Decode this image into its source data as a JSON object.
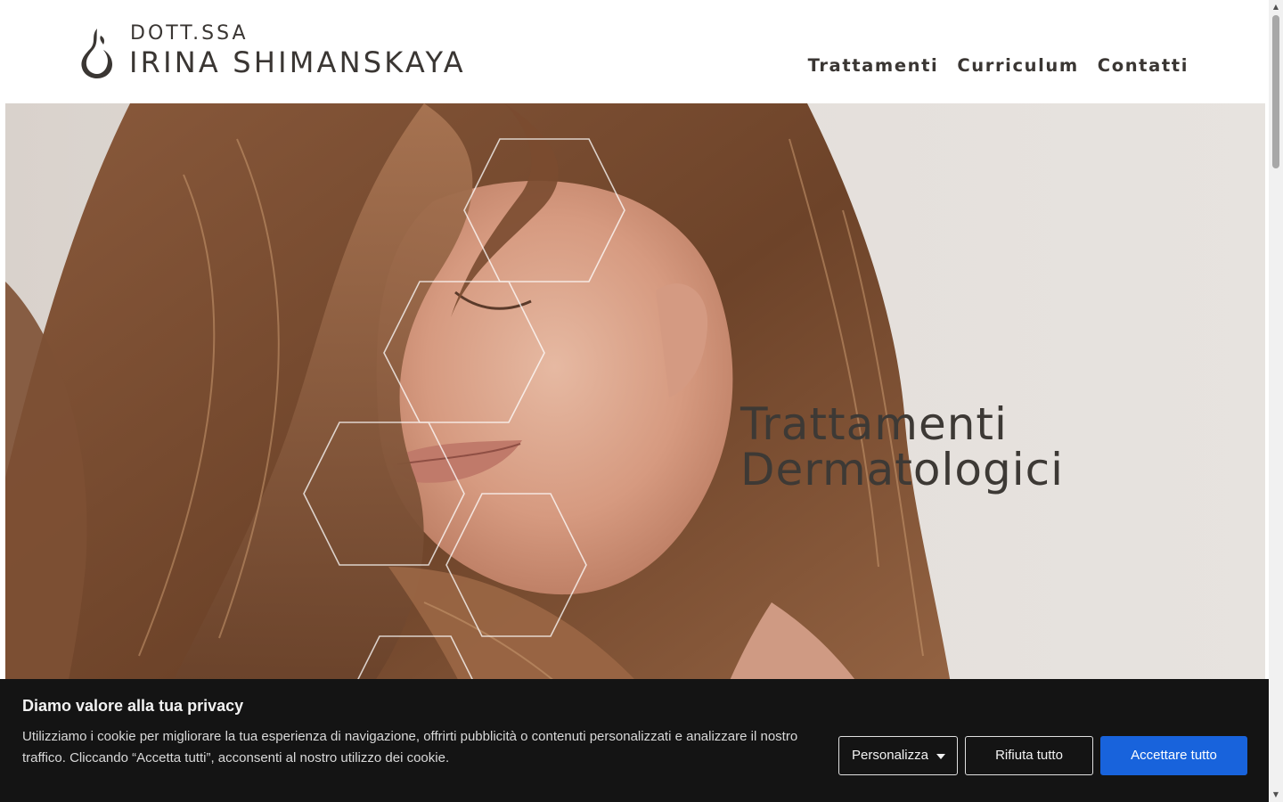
{
  "header": {
    "logo_title": "DOTT.SSA",
    "logo_name": "IRINA SHIMANSKAYA",
    "nav": [
      {
        "label": "Trattamenti"
      },
      {
        "label": "Curriculum"
      },
      {
        "label": "Contatti"
      }
    ]
  },
  "hero": {
    "title_line1": "Trattamenti",
    "title_line2": "Dermatologici"
  },
  "cookie_banner": {
    "title": "Diamo valore alla tua privacy",
    "text": "Utilizziamo i cookie per migliorare la tua esperienza di navigazione, offrirti pubblicità o contenuti personalizzati e analizzare il nostro traffico. Cliccando “Accetta tutti”, acconsenti al nostro utilizzo dei cookie.",
    "customize_label": "Personalizza",
    "reject_label": "Rifiuta tutto",
    "accept_label": "Accettare tutto"
  },
  "colors": {
    "text_dark": "#3a3633",
    "banner_bg": "#141414",
    "accept_blue": "#1863dc"
  },
  "icons": {
    "logo": "flame-logo-icon",
    "dropdown": "caret-down-icon",
    "scroll_up": "arrow-up-icon",
    "scroll_down": "arrow-down-icon"
  }
}
